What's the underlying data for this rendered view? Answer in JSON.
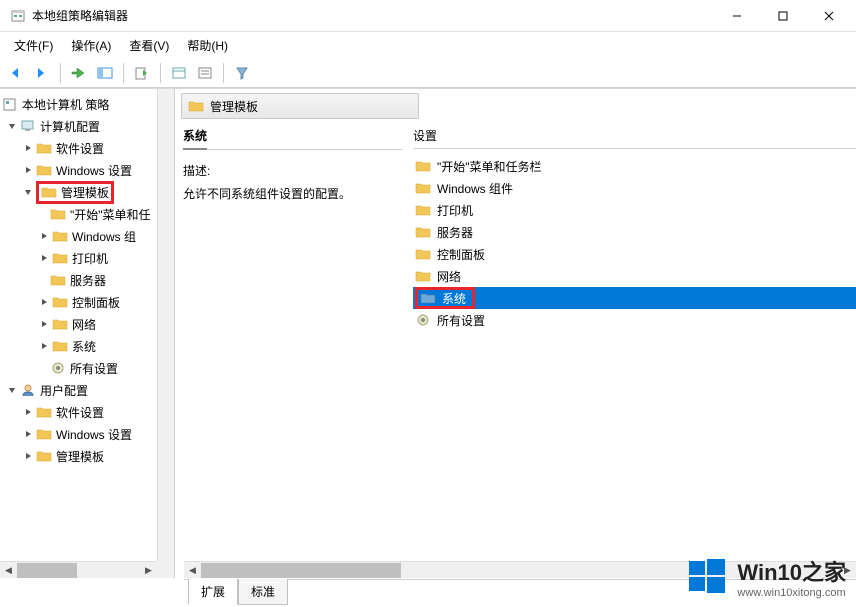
{
  "window": {
    "title": "本地组策略编辑器"
  },
  "menu": {
    "file": "文件(F)",
    "action": "操作(A)",
    "view": "查看(V)",
    "help": "帮助(H)"
  },
  "tree": {
    "root": "本地计算机 策略",
    "computer_config": "计算机配置",
    "software_settings": "软件设置",
    "windows_settings": "Windows 设置",
    "admin_templates": "管理模板",
    "start_menu": "\"开始\"菜单和任",
    "windows_comp": "Windows 组",
    "printers": "打印机",
    "servers": "服务器",
    "control_panel": "控制面板",
    "network": "网络",
    "system": "系统",
    "all_settings": "所有设置",
    "user_config": "用户配置",
    "u_software": "软件设置",
    "u_windows": "Windows 设置",
    "u_admin": "管理模板"
  },
  "header": {
    "title": "管理模板"
  },
  "description": {
    "section_title": "系统",
    "label": "描述:",
    "text": "允许不同系统组件设置的配置。"
  },
  "settings": {
    "column_header": "设置",
    "items": {
      "start_menu": "\"开始\"菜单和任务栏",
      "windows_comp": "Windows 组件",
      "printers": "打印机",
      "servers": "服务器",
      "control_panel": "控制面板",
      "network": "网络",
      "system": "系统",
      "all_settings": "所有设置"
    }
  },
  "tabs": {
    "extended": "扩展",
    "standard": "标准"
  },
  "brand": {
    "title": "Win10之家",
    "url": "www.win10xitong.com"
  }
}
